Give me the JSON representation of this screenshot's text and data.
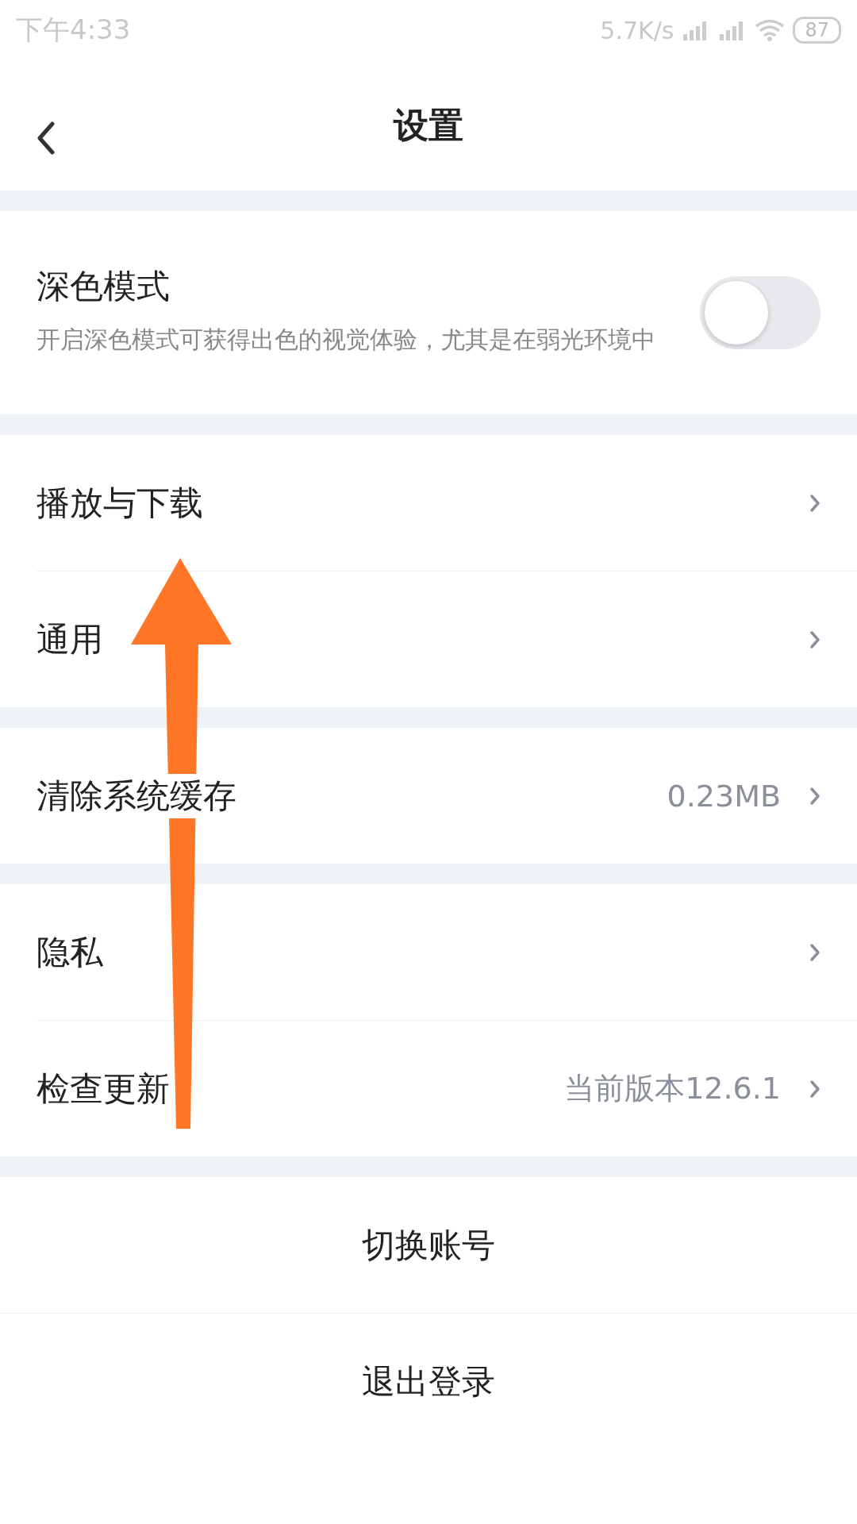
{
  "status_bar": {
    "time": "下午4:33",
    "speed": "5.7K/s",
    "battery": "87"
  },
  "header": {
    "title": "设置"
  },
  "sections": [
    {
      "items": [
        {
          "kind": "toggle",
          "label": "深色模式",
          "description": "开启深色模式可获得出色的视觉体验，尤其是在弱光环境中",
          "on": false
        }
      ]
    },
    {
      "items": [
        {
          "kind": "link",
          "label": "播放与下载"
        },
        {
          "kind": "link",
          "label": "通用"
        }
      ]
    },
    {
      "items": [
        {
          "kind": "link",
          "label": "清除系统缓存",
          "value": "0.23MB"
        }
      ]
    },
    {
      "items": [
        {
          "kind": "link",
          "label": "隐私"
        },
        {
          "kind": "link",
          "label": "检查更新",
          "value": "当前版本12.6.1"
        }
      ]
    },
    {
      "items": [
        {
          "kind": "action",
          "label": "切换账号"
        },
        {
          "kind": "action",
          "label": "退出登录"
        }
      ]
    }
  ],
  "annotation": {
    "kind": "arrow"
  }
}
